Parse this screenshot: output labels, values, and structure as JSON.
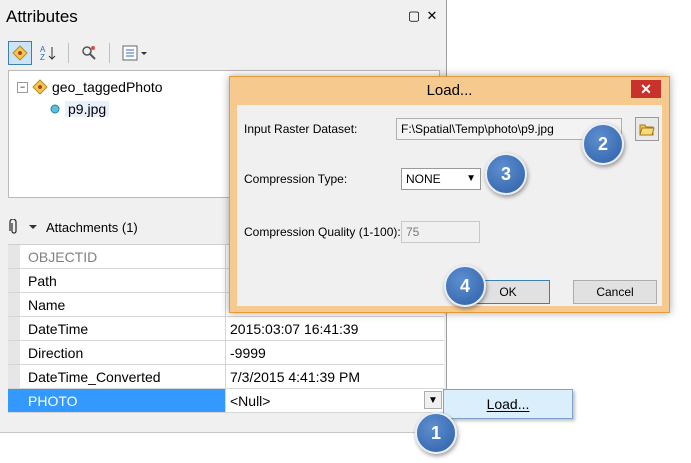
{
  "attributes_panel": {
    "title": "Attributes",
    "pin_symbol": "▢",
    "close_symbol": "✕",
    "tree": {
      "layer_name": "geo_taggedPhoto",
      "feature_name": "p9.jpg"
    },
    "attachments_label": "Attachments (1)",
    "rows": [
      {
        "field": "OBJECTID",
        "value": ""
      },
      {
        "field": "Path",
        "value": ""
      },
      {
        "field": "Name",
        "value": ""
      },
      {
        "field": "DateTime",
        "value": "2015:03:07 16:41:39"
      },
      {
        "field": "Direction",
        "value": "-9999"
      },
      {
        "field": "DateTime_Converted",
        "value": "7/3/2015 4:41:39 PM"
      },
      {
        "field": "PHOTO",
        "value": "<Null>"
      }
    ],
    "load_menu_label": "Load..."
  },
  "load_dialog": {
    "title": "Load...",
    "close_symbol": "✕",
    "input_raster_label": "Input Raster Dataset:",
    "input_raster_value": "F:\\Spatial\\Temp\\photo\\p9.jpg",
    "compression_type_label": "Compression Type:",
    "compression_type_value": "NONE",
    "compression_quality_label": "Compression Quality (1-100):",
    "compression_quality_value": "75",
    "ok_label": "OK",
    "cancel_label": "Cancel"
  },
  "callouts": {
    "one": "1",
    "two": "2",
    "three": "3",
    "four": "4"
  },
  "colors": {
    "selection": "#3399ff",
    "dialog_frame": "#f6c98f",
    "close_red": "#c7332c",
    "callout_blue": "#3b6fb8"
  }
}
